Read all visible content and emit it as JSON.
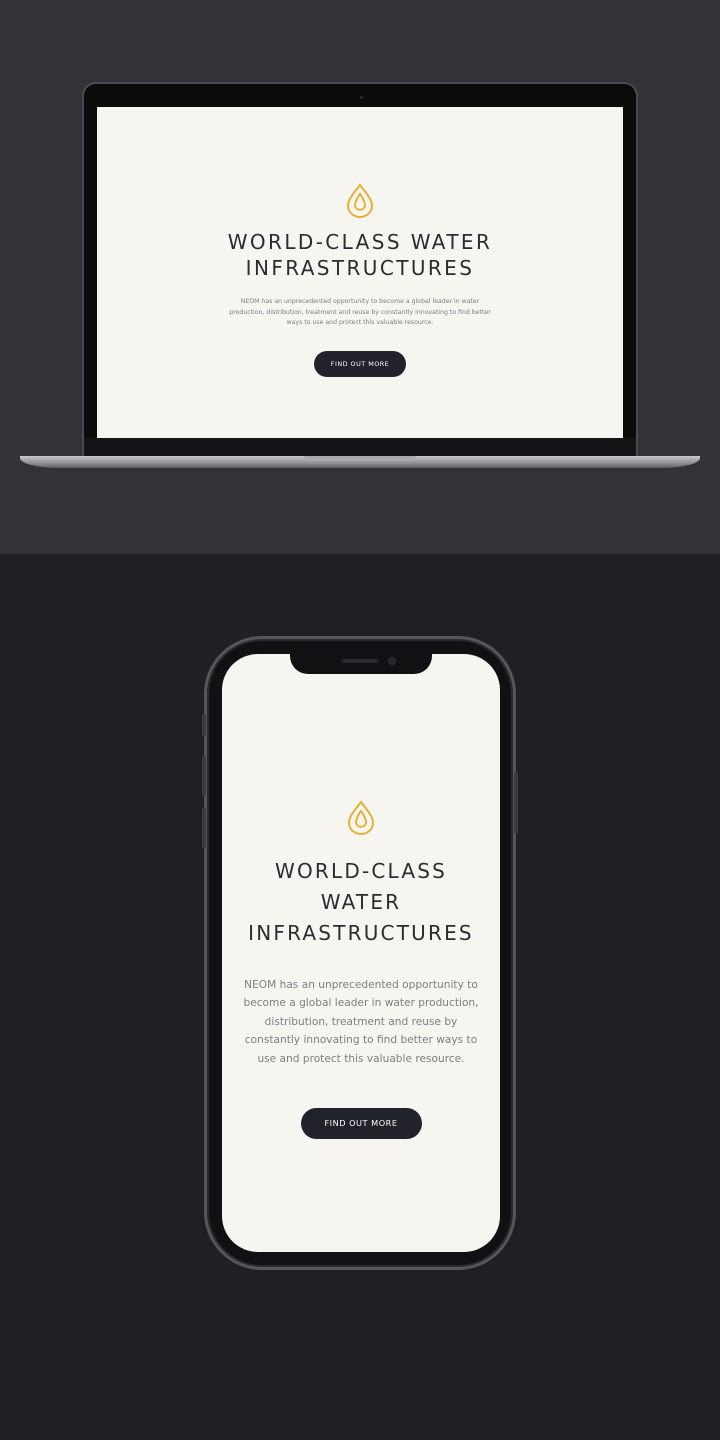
{
  "laptop_page": {
    "icon": "water-drop-icon",
    "title_line1": "WORLD-CLASS WATER",
    "title_line2": "INFRASTRUCTURES",
    "body_line1": "NEOM has an unprecedented opportunity to become a global leader in water",
    "body_line2": "production, distribution, treatment and reuse by constantly innovating to find better",
    "body_line3": "ways to use and protect this valuable resource.",
    "cta_label": "FIND OUT MORE"
  },
  "phone_page": {
    "icon": "water-drop-icon",
    "title_line1": "WORLD-CLASS",
    "title_line2": "WATER",
    "title_line3": "INFRASTRUCTURES",
    "body_line1": "NEOM has an unprecedented opportunity to",
    "body_line2": "become a global leader in water production,",
    "body_line3": "distribution, treatment and reuse by",
    "body_line4": "constantly innovating to find better ways to",
    "body_line5": "use and protect this valuable resource.",
    "cta_label": "FIND OUT MORE"
  },
  "colors": {
    "accent_gold": "#e2b23a",
    "page_background": "#f6f5f0",
    "button_background": "#22232a",
    "top_panel": "#323338",
    "bottom_panel": "#1f2024"
  }
}
